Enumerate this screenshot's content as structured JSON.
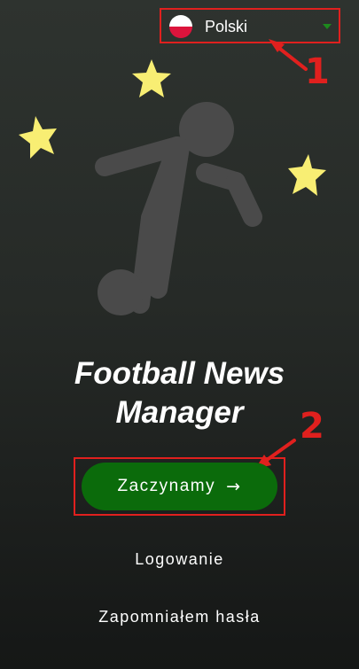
{
  "language": {
    "label": "Polski",
    "flag": "poland-flag-icon"
  },
  "annotations": {
    "one": "1",
    "two": "2"
  },
  "app": {
    "title_line1": "Football News",
    "title_line2": "Manager"
  },
  "actions": {
    "start_label": "Zaczynamy",
    "start_arrow": "→",
    "login_label": "Logowanie",
    "forgot_label": "Zapomniałem hasła"
  },
  "colors": {
    "accent_green": "#0b6b0b",
    "annotation_red": "#e0201e",
    "star_yellow": "#f8ee73",
    "silhouette_gray": "#4a4a4a"
  }
}
